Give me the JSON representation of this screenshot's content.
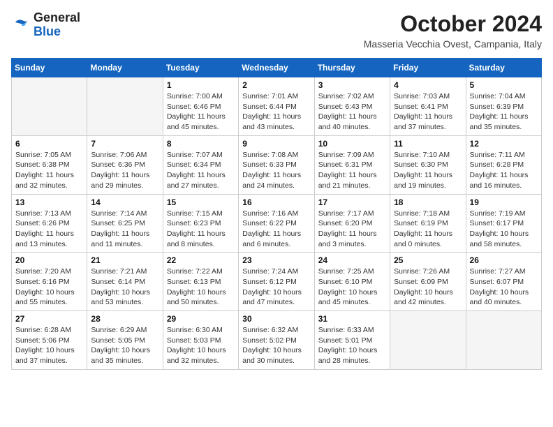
{
  "header": {
    "logo_line1": "General",
    "logo_line2": "Blue",
    "month": "October 2024",
    "location": "Masseria Vecchia Ovest, Campania, Italy"
  },
  "days_of_week": [
    "Sunday",
    "Monday",
    "Tuesday",
    "Wednesday",
    "Thursday",
    "Friday",
    "Saturday"
  ],
  "weeks": [
    [
      {
        "day": "",
        "info": ""
      },
      {
        "day": "",
        "info": ""
      },
      {
        "day": "1",
        "info": "Sunrise: 7:00 AM\nSunset: 6:46 PM\nDaylight: 11 hours and 45 minutes."
      },
      {
        "day": "2",
        "info": "Sunrise: 7:01 AM\nSunset: 6:44 PM\nDaylight: 11 hours and 43 minutes."
      },
      {
        "day": "3",
        "info": "Sunrise: 7:02 AM\nSunset: 6:43 PM\nDaylight: 11 hours and 40 minutes."
      },
      {
        "day": "4",
        "info": "Sunrise: 7:03 AM\nSunset: 6:41 PM\nDaylight: 11 hours and 37 minutes."
      },
      {
        "day": "5",
        "info": "Sunrise: 7:04 AM\nSunset: 6:39 PM\nDaylight: 11 hours and 35 minutes."
      }
    ],
    [
      {
        "day": "6",
        "info": "Sunrise: 7:05 AM\nSunset: 6:38 PM\nDaylight: 11 hours and 32 minutes."
      },
      {
        "day": "7",
        "info": "Sunrise: 7:06 AM\nSunset: 6:36 PM\nDaylight: 11 hours and 29 minutes."
      },
      {
        "day": "8",
        "info": "Sunrise: 7:07 AM\nSunset: 6:34 PM\nDaylight: 11 hours and 27 minutes."
      },
      {
        "day": "9",
        "info": "Sunrise: 7:08 AM\nSunset: 6:33 PM\nDaylight: 11 hours and 24 minutes."
      },
      {
        "day": "10",
        "info": "Sunrise: 7:09 AM\nSunset: 6:31 PM\nDaylight: 11 hours and 21 minutes."
      },
      {
        "day": "11",
        "info": "Sunrise: 7:10 AM\nSunset: 6:30 PM\nDaylight: 11 hours and 19 minutes."
      },
      {
        "day": "12",
        "info": "Sunrise: 7:11 AM\nSunset: 6:28 PM\nDaylight: 11 hours and 16 minutes."
      }
    ],
    [
      {
        "day": "13",
        "info": "Sunrise: 7:13 AM\nSunset: 6:26 PM\nDaylight: 11 hours and 13 minutes."
      },
      {
        "day": "14",
        "info": "Sunrise: 7:14 AM\nSunset: 6:25 PM\nDaylight: 11 hours and 11 minutes."
      },
      {
        "day": "15",
        "info": "Sunrise: 7:15 AM\nSunset: 6:23 PM\nDaylight: 11 hours and 8 minutes."
      },
      {
        "day": "16",
        "info": "Sunrise: 7:16 AM\nSunset: 6:22 PM\nDaylight: 11 hours and 6 minutes."
      },
      {
        "day": "17",
        "info": "Sunrise: 7:17 AM\nSunset: 6:20 PM\nDaylight: 11 hours and 3 minutes."
      },
      {
        "day": "18",
        "info": "Sunrise: 7:18 AM\nSunset: 6:19 PM\nDaylight: 11 hours and 0 minutes."
      },
      {
        "day": "19",
        "info": "Sunrise: 7:19 AM\nSunset: 6:17 PM\nDaylight: 10 hours and 58 minutes."
      }
    ],
    [
      {
        "day": "20",
        "info": "Sunrise: 7:20 AM\nSunset: 6:16 PM\nDaylight: 10 hours and 55 minutes."
      },
      {
        "day": "21",
        "info": "Sunrise: 7:21 AM\nSunset: 6:14 PM\nDaylight: 10 hours and 53 minutes."
      },
      {
        "day": "22",
        "info": "Sunrise: 7:22 AM\nSunset: 6:13 PM\nDaylight: 10 hours and 50 minutes."
      },
      {
        "day": "23",
        "info": "Sunrise: 7:24 AM\nSunset: 6:12 PM\nDaylight: 10 hours and 47 minutes."
      },
      {
        "day": "24",
        "info": "Sunrise: 7:25 AM\nSunset: 6:10 PM\nDaylight: 10 hours and 45 minutes."
      },
      {
        "day": "25",
        "info": "Sunrise: 7:26 AM\nSunset: 6:09 PM\nDaylight: 10 hours and 42 minutes."
      },
      {
        "day": "26",
        "info": "Sunrise: 7:27 AM\nSunset: 6:07 PM\nDaylight: 10 hours and 40 minutes."
      }
    ],
    [
      {
        "day": "27",
        "info": "Sunrise: 6:28 AM\nSunset: 5:06 PM\nDaylight: 10 hours and 37 minutes."
      },
      {
        "day": "28",
        "info": "Sunrise: 6:29 AM\nSunset: 5:05 PM\nDaylight: 10 hours and 35 minutes."
      },
      {
        "day": "29",
        "info": "Sunrise: 6:30 AM\nSunset: 5:03 PM\nDaylight: 10 hours and 32 minutes."
      },
      {
        "day": "30",
        "info": "Sunrise: 6:32 AM\nSunset: 5:02 PM\nDaylight: 10 hours and 30 minutes."
      },
      {
        "day": "31",
        "info": "Sunrise: 6:33 AM\nSunset: 5:01 PM\nDaylight: 10 hours and 28 minutes."
      },
      {
        "day": "",
        "info": ""
      },
      {
        "day": "",
        "info": ""
      }
    ]
  ]
}
